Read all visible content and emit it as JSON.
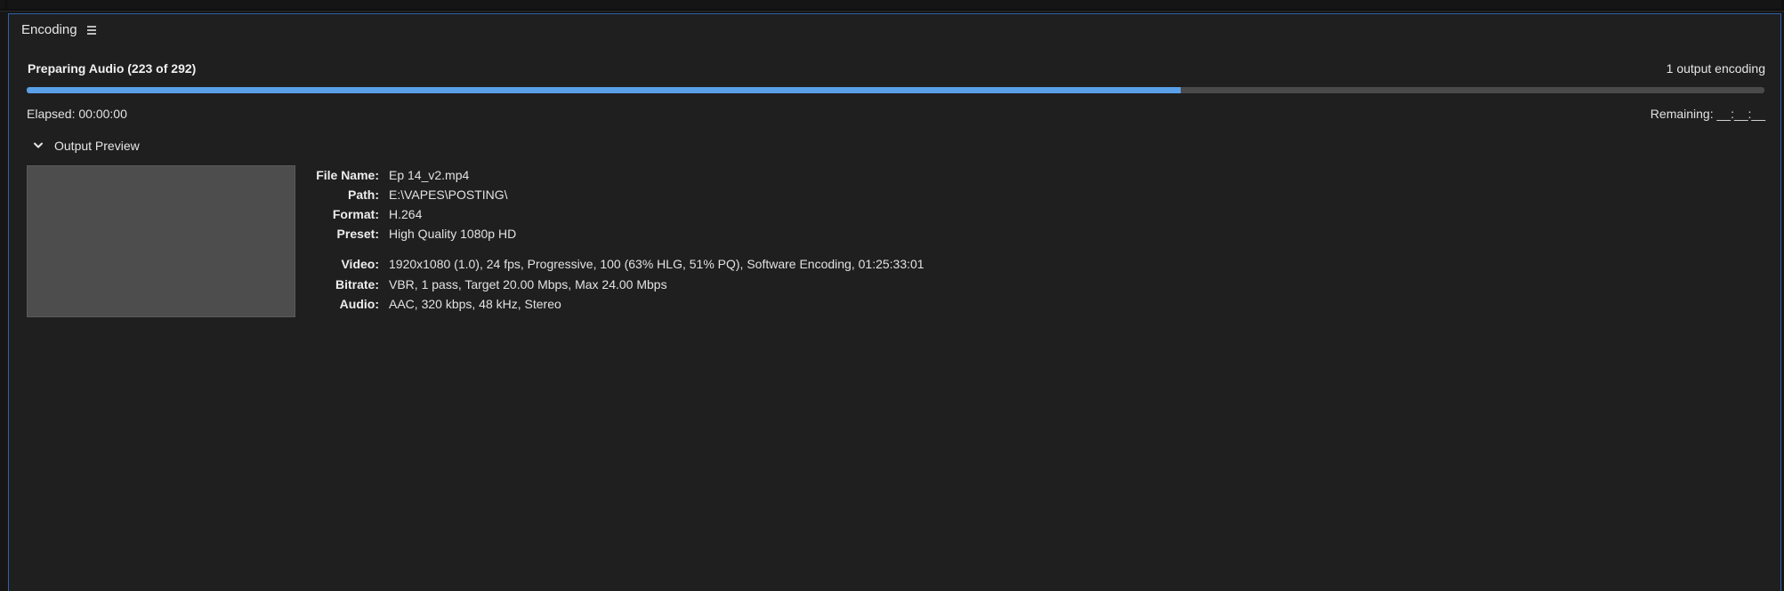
{
  "panel": {
    "title": "Encoding",
    "menu_icon": "hamburger-menu-icon"
  },
  "status": {
    "label": "Preparing Audio (223 of 292)",
    "outputs": "1 output encoding",
    "progress_fraction": 0.664,
    "progress_color": "#5aa0e8",
    "elapsed": "Elapsed: 00:00:00",
    "remaining": "Remaining: __:__:__"
  },
  "preview": {
    "toggle_label": "Output Preview",
    "toggle_icon": "chevron-down-icon",
    "expanded": true
  },
  "details": {
    "file_name": {
      "label": "File Name:",
      "value": "Ep 14_v2.mp4"
    },
    "path": {
      "label": "Path:",
      "value": "E:\\VAPES\\POSTING\\"
    },
    "format": {
      "label": "Format:",
      "value": "H.264"
    },
    "preset": {
      "label": "Preset:",
      "value": "High Quality 1080p HD"
    },
    "video": {
      "label": "Video:",
      "value": "1920x1080 (1.0), 24 fps, Progressive, 100 (63% HLG, 51% PQ), Software Encoding, 01:25:33:01"
    },
    "bitrate": {
      "label": "Bitrate:",
      "value": "VBR, 1 pass, Target 20.00 Mbps, Max 24.00 Mbps"
    },
    "audio": {
      "label": "Audio:",
      "value": "AAC, 320 kbps, 48 kHz, Stereo"
    }
  }
}
